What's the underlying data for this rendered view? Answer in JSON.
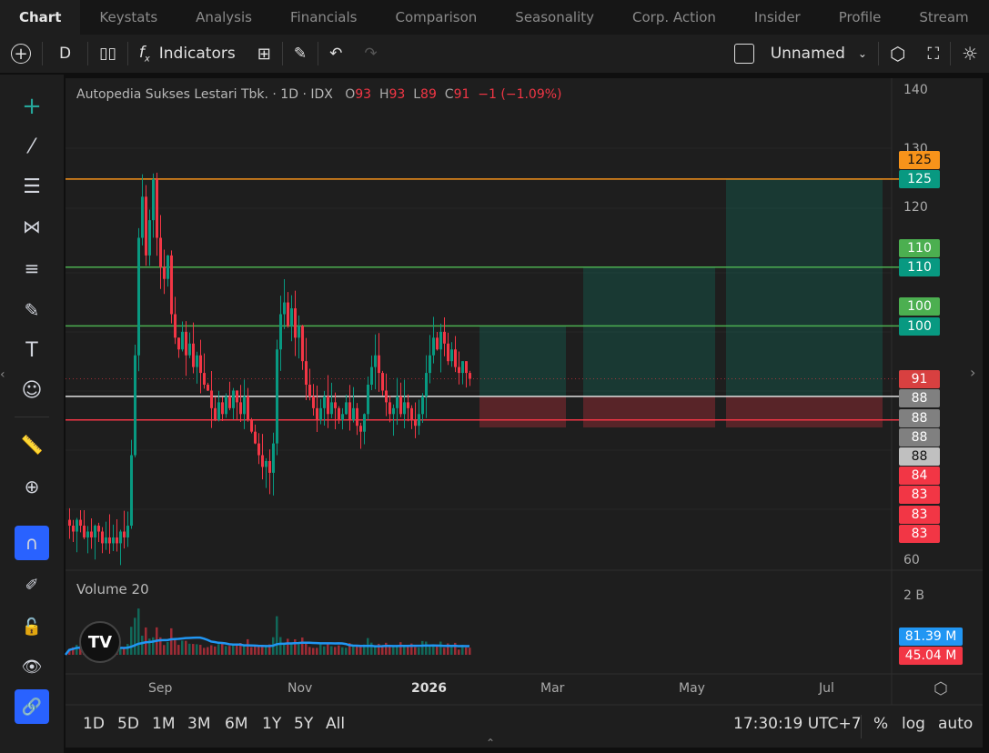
{
  "tabs": [
    "Chart",
    "Keystats",
    "Analysis",
    "Financials",
    "Comparison",
    "Seasonality",
    "Corp. Action",
    "Insider",
    "Profile",
    "Stream"
  ],
  "toolbar": {
    "interval": "D",
    "indicators": "Indicators",
    "layout_name": "Unnamed"
  },
  "legend": {
    "name": "Autopedia Sukses Lestari Tbk. · 1D · IDX",
    "o_label": "O",
    "o": "93",
    "h_label": "H",
    "h": "93",
    "l_label": "L",
    "l": "89",
    "c_label": "C",
    "c": "91",
    "change": "−1 (−1.09%)"
  },
  "price_axis": [
    "140",
    "130",
    "120",
    "60"
  ],
  "price_labels": [
    {
      "text": "125",
      "price": 125,
      "bg": "#f7931a",
      "fg": "#111"
    },
    {
      "text": "125",
      "price": 125,
      "bg": "#089981",
      "fg": "#fff"
    },
    {
      "text": "110",
      "price": 110,
      "bg": "#4caf50",
      "fg": "#fff"
    },
    {
      "text": "110",
      "price": 110,
      "bg": "#089981",
      "fg": "#fff"
    },
    {
      "text": "100",
      "price": 100,
      "bg": "#4caf50",
      "fg": "#fff"
    },
    {
      "text": "100",
      "price": 100,
      "bg": "#089981",
      "fg": "#fff"
    },
    {
      "text": "91",
      "price": 91,
      "bg": "#d84040",
      "fg": "#fff"
    },
    {
      "text": "88",
      "price": 88,
      "bg": "#808080",
      "fg": "#fff"
    },
    {
      "text": "88",
      "price": 88,
      "bg": "#808080",
      "fg": "#fff"
    },
    {
      "text": "88",
      "price": 88,
      "bg": "#808080",
      "fg": "#fff"
    },
    {
      "text": "88",
      "price": 88,
      "bg": "#c0c0c0",
      "fg": "#111"
    },
    {
      "text": "84",
      "price": 84,
      "bg": "#f23645",
      "fg": "#fff"
    },
    {
      "text": "83",
      "price": 83,
      "bg": "#f23645",
      "fg": "#fff"
    },
    {
      "text": "83",
      "price": 83,
      "bg": "#f23645",
      "fg": "#fff"
    },
    {
      "text": "83",
      "price": 83,
      "bg": "#f23645",
      "fg": "#fff"
    }
  ],
  "volume": {
    "title": "Volume 20",
    "axis": "2 B",
    "ma_label": "81.39 M",
    "vol_label": "45.04 M",
    "ma_color": "#2196f3",
    "vol_color": "#f23645"
  },
  "time_axis": [
    "Sep",
    "Nov",
    "2026",
    "Mar",
    "May",
    "Jul"
  ],
  "ranges": [
    "1D",
    "5D",
    "1M",
    "3M",
    "6M",
    "1Y",
    "5Y",
    "All"
  ],
  "clock": "17:30:19 UTC+7",
  "scale_opts": [
    "%",
    "log",
    "auto"
  ],
  "colors": {
    "up": "#089981",
    "down": "#f23645",
    "orange": "#f7931a",
    "green_line": "#4caf50",
    "accent": "#2962ff"
  },
  "chart_data": {
    "type": "candlestick",
    "closes": [
      66,
      65,
      67,
      66,
      64,
      65,
      64,
      66,
      65,
      63,
      64,
      63,
      64,
      63,
      65,
      64,
      66,
      78,
      95,
      115,
      122,
      112,
      118,
      125,
      115,
      110,
      108,
      112,
      102,
      98,
      96,
      99,
      95,
      97,
      93,
      95,
      92,
      90,
      89,
      86,
      84,
      87,
      85,
      88,
      86,
      89,
      87,
      85,
      88,
      84,
      82,
      80,
      78,
      76,
      77,
      75,
      80,
      96,
      102,
      104,
      100,
      103,
      98,
      100,
      94,
      90,
      88,
      86,
      84,
      86,
      88,
      85,
      87,
      86,
      84,
      85,
      87,
      84,
      86,
      83,
      82,
      85,
      90,
      93,
      95,
      92,
      89,
      87,
      85,
      86,
      88,
      85,
      87,
      86,
      84,
      83,
      85,
      88,
      92,
      95,
      98,
      96,
      99,
      97,
      94,
      96,
      93,
      92,
      94,
      92,
      91
    ],
    "hlines": [
      125,
      110,
      100,
      88,
      84
    ],
    "ylim": [
      60,
      140
    ]
  }
}
